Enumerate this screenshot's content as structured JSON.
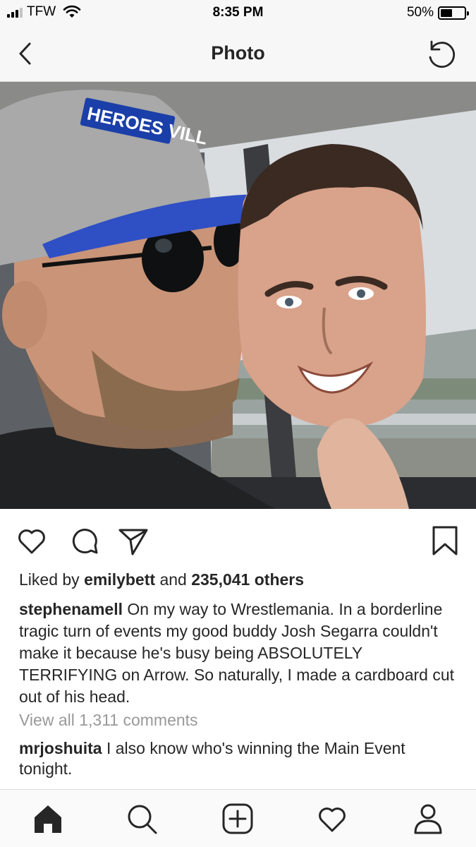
{
  "status_bar": {
    "carrier": "TFW",
    "time": "8:35 PM",
    "battery": "50%",
    "battery_level": 0.5,
    "icons": [
      "signal-icon",
      "wifi-icon",
      "battery-icon"
    ]
  },
  "nav": {
    "title": "Photo",
    "back_icon": "chevron-left-icon",
    "refresh_icon": "refresh-icon"
  },
  "photo": {
    "cap_text": "HEROES VILL"
  },
  "actions": {
    "icons": [
      "heart-icon",
      "comment-icon",
      "share-icon",
      "bookmark-icon"
    ]
  },
  "likes": {
    "prefix": "Liked by",
    "user": "emilybett",
    "middle": "and",
    "others": "235,041 others"
  },
  "caption": {
    "user": "stephenamell",
    "text": "On my way to Wrestlemania. In a borderline tragic turn of events my good buddy Josh Segarra couldn't make it because he's busy being ABSOLUTELY TERRIFYING on Arrow. So naturally, I made a cardboard cut out of his head."
  },
  "view_comments": "View all 1,311 comments",
  "comment": {
    "user": "mrjoshuita",
    "text": "I also know who's winning the Main Event tonight."
  },
  "tab_bar": {
    "icons": [
      "home-icon",
      "search-icon",
      "add-icon",
      "activity-heart-icon",
      "profile-icon"
    ]
  },
  "colors": {
    "text": "#262626",
    "muted": "#999999",
    "bar_bg": "#f7f7f7",
    "divider": "#dbdbdb"
  }
}
